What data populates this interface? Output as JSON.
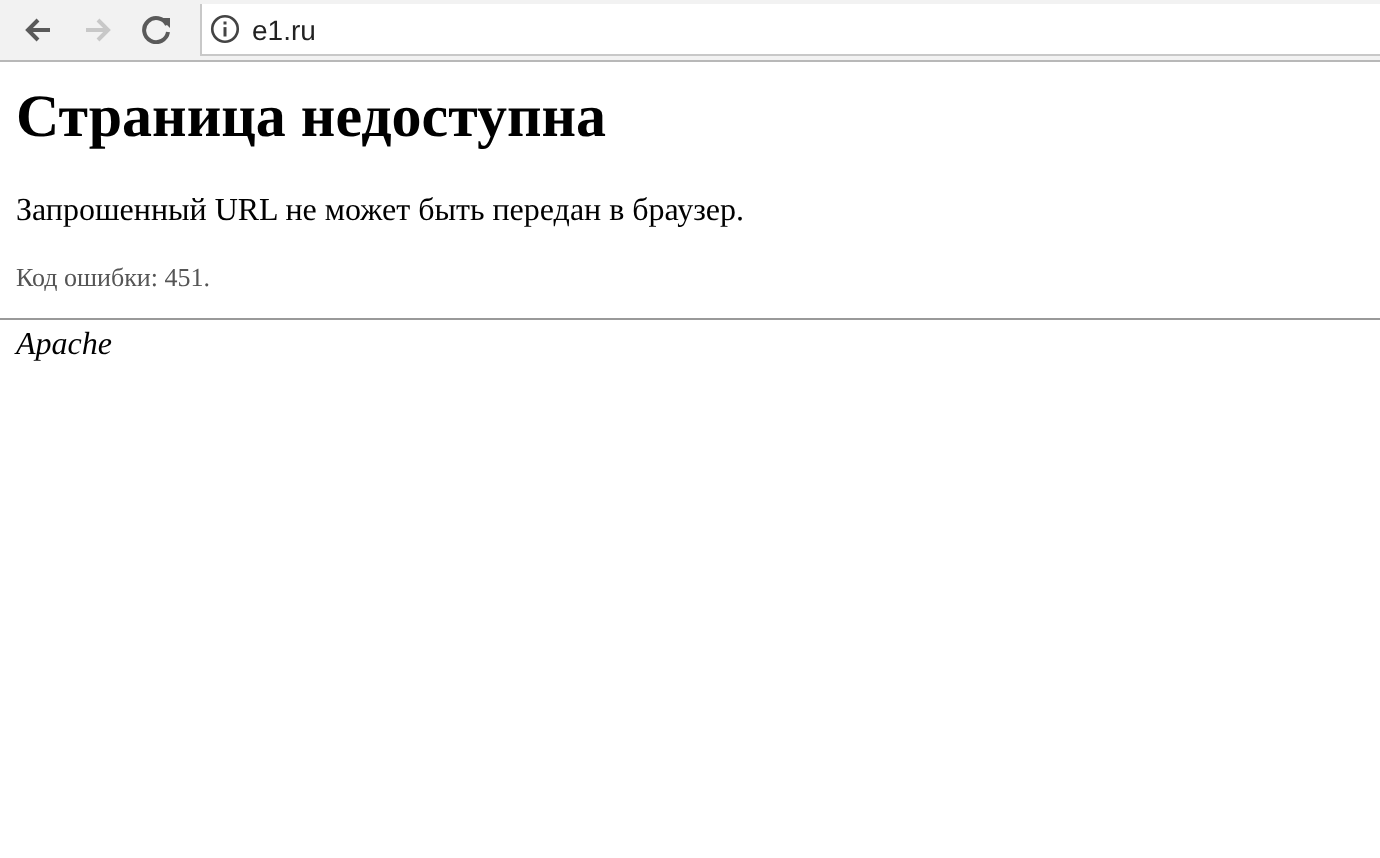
{
  "toolbar": {
    "nav_buttons": [
      {
        "kind": "back",
        "disabled": false
      },
      {
        "kind": "forward",
        "disabled": true
      },
      {
        "kind": "reload",
        "disabled": false
      }
    ],
    "address": {
      "value": "e1.ru"
    }
  },
  "page": {
    "title": "Страница недоступна",
    "message": "Запрошенный URL не может быть передан в браузер.",
    "error_code": "Код ошибки: 451.",
    "footer": "Apache"
  }
}
